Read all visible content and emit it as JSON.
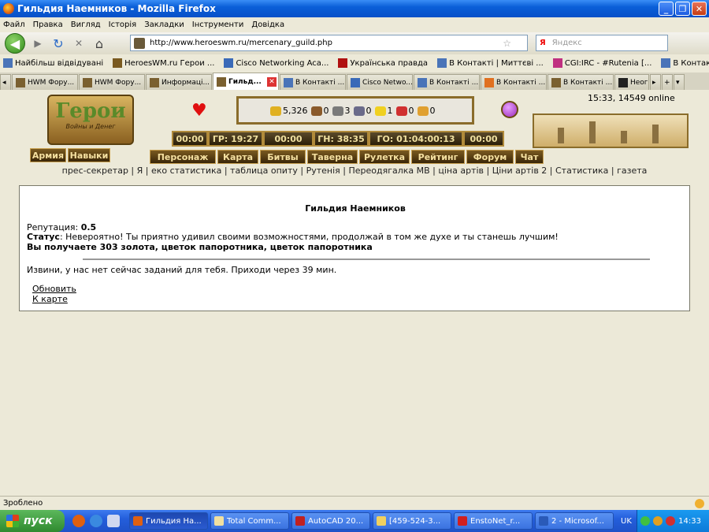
{
  "window": {
    "title": "Гильдия Наемников - Mozilla Firefox",
    "min": "_",
    "max": "❐",
    "close": "✕"
  },
  "menu": [
    "Файл",
    "Правка",
    "Вигляд",
    "Історія",
    "Закладки",
    "Інструменти",
    "Довідка"
  ],
  "nav": {
    "back": "◀",
    "forward": "▶",
    "reload": "↻",
    "stop": "✕",
    "home": "⌂",
    "url": "http://www.heroeswm.ru/mercenary_guild.php",
    "search_logo": "Я",
    "search_placeholder": "Яндекс"
  },
  "bookmarks": [
    "Найбільш відвідувані",
    "HeroesWM.ru Герои ...",
    "Cisco Networking Aca...",
    "Українська правда",
    "В Контакті | Миттєві ...",
    "CGI:IRC - #Rutenia [...",
    "В Контакті | Друзі"
  ],
  "tabs": [
    {
      "label": "HWM Фору..."
    },
    {
      "label": "HWM Фору..."
    },
    {
      "label": "Информаці..."
    },
    {
      "label": "Гильд...",
      "active": true
    },
    {
      "label": "В Контакті ..."
    },
    {
      "label": "Cisco Netwo..."
    },
    {
      "label": "В Контакті ..."
    },
    {
      "label": "В Контакті ..."
    },
    {
      "label": "В Контакті ..."
    },
    {
      "label": "Неог..."
    }
  ],
  "game": {
    "logo_title": "Герои",
    "logo_subtitle": "Войны и Денег",
    "online": "15:33, 14549 online",
    "resources": [
      {
        "name": "gold",
        "value": "5,326",
        "color": "#e0b020"
      },
      {
        "name": "wood",
        "value": "0",
        "color": "#8a5a2a"
      },
      {
        "name": "ore",
        "value": "3",
        "color": "#7a7a7a"
      },
      {
        "name": "mercury",
        "value": "0",
        "color": "#6a6a8a"
      },
      {
        "name": "sulfur",
        "value": "1",
        "color": "#f0d020"
      },
      {
        "name": "crystals",
        "value": "0",
        "color": "#d03030"
      },
      {
        "name": "gems",
        "value": "0",
        "color": "#e0a030"
      }
    ],
    "timers": [
      "00:00",
      "ГР: 19:27",
      "00:00",
      "ГН: 38:35",
      "ГО: 01:04:00:13",
      "00:00"
    ],
    "skills_buttons": [
      "Армия",
      "Навыки"
    ],
    "main_menu": [
      "Персонаж",
      "Карта",
      "Битвы",
      "Таверна",
      "Рулетка",
      "Рейтинг",
      "Форум",
      "Чат"
    ],
    "links": "прес-секретар | Я | еко статистика | таблица опиту | Рутенія | Переодягалка МВ | ціна артів | Ціни артів 2 | Статистика | газета"
  },
  "panel": {
    "title": "Гильдия Наемников",
    "reputation_label": "Репутация:",
    "reputation_value": "0.5",
    "status_label": "Статус",
    "status_text": ": Невероятно! Ты приятно удивил своими возможностями, продолжай в том же духе и ты станешь лучшим!",
    "reward": "Вы получаете 303 золота, цветок папоротника, цветок папоротника",
    "no_tasks": "Извини, у нас нет сейчас заданий для тебя. Приходи через 39 мин.",
    "refresh_link": "Обновить",
    "map_link": "К карте"
  },
  "status_bar": "Зроблено",
  "taskbar": {
    "start": "пуск",
    "items": [
      {
        "label": "Гильдия На...",
        "active": true
      },
      {
        "label": "Total Comm..."
      },
      {
        "label": "AutoCAD 20..."
      },
      {
        "label": "[459-524-3..."
      },
      {
        "label": "EnstoNet_r..."
      },
      {
        "label": "2 - Microsof..."
      }
    ],
    "lang": "UK",
    "clock": "14:33"
  }
}
